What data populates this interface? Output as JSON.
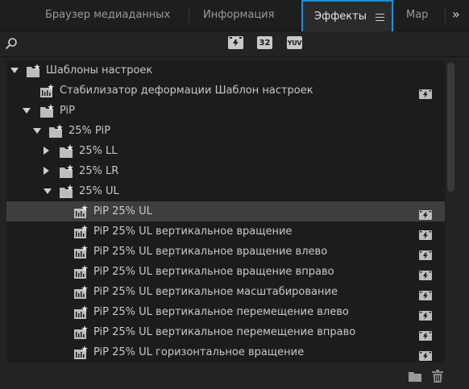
{
  "tabs": [
    {
      "label": "Браузер медиаданных",
      "active": false
    },
    {
      "label": "Информация",
      "active": false
    },
    {
      "label": "Эффекты",
      "active": true
    },
    {
      "label": "Мар",
      "active": false
    }
  ],
  "overflow_glyph": "»",
  "toolbar": {
    "accelerated_glyph": "",
    "bit32_label": "32",
    "yuv_label": "YUV"
  },
  "tree": [
    {
      "label": "Шаблоны настроек",
      "kind": "folder",
      "expand": "down",
      "depth": 0,
      "accel": false,
      "selected": false
    },
    {
      "label": "Стабилизатор деформации Шаблон настроек",
      "kind": "preset",
      "expand": "none",
      "depth": 1,
      "accel": true,
      "selected": false
    },
    {
      "label": "PiP",
      "kind": "folder",
      "expand": "down",
      "depth": 1,
      "accel": false,
      "selected": false
    },
    {
      "label": "25% PiP",
      "kind": "folder",
      "expand": "down",
      "depth": 2,
      "accel": false,
      "selected": false
    },
    {
      "label": "25% LL",
      "kind": "folder",
      "expand": "right",
      "depth": 3,
      "accel": false,
      "selected": false
    },
    {
      "label": "25% LR",
      "kind": "folder",
      "expand": "right",
      "depth": 3,
      "accel": false,
      "selected": false
    },
    {
      "label": "25% UL",
      "kind": "folder",
      "expand": "down",
      "depth": 3,
      "accel": false,
      "selected": false
    },
    {
      "label": "PiP 25% UL",
      "kind": "preset",
      "expand": "none",
      "depth": 4,
      "accel": true,
      "selected": true
    },
    {
      "label": "PiP 25% UL вертикальное вращение",
      "kind": "preset",
      "expand": "none",
      "depth": 4,
      "accel": true,
      "selected": false
    },
    {
      "label": "PiP 25% UL вертикальное вращение влево",
      "kind": "preset",
      "expand": "none",
      "depth": 4,
      "accel": true,
      "selected": false
    },
    {
      "label": "PiP 25% UL вертикальное вращение вправо",
      "kind": "preset",
      "expand": "none",
      "depth": 4,
      "accel": true,
      "selected": false
    },
    {
      "label": "PiP 25% UL вертикальное масштабирование",
      "kind": "preset",
      "expand": "none",
      "depth": 4,
      "accel": true,
      "selected": false
    },
    {
      "label": "PiP 25% UL вертикальное перемещение влево",
      "kind": "preset",
      "expand": "none",
      "depth": 4,
      "accel": true,
      "selected": false
    },
    {
      "label": "PiP 25% UL вертикальное перемещение вправо",
      "kind": "preset",
      "expand": "none",
      "depth": 4,
      "accel": true,
      "selected": false
    },
    {
      "label": "PiP 25% UL горизонтальное вращение",
      "kind": "preset",
      "expand": "none",
      "depth": 4,
      "accel": true,
      "selected": false
    }
  ],
  "icons": {
    "search": "search-icon",
    "new_bin": "new-folder-icon",
    "delete": "trash-icon"
  },
  "colors": {
    "accent": "#1b8fe0",
    "panel_bg": "#232323",
    "tree_bg": "#1c1c1c",
    "selected_row": "#3e3e3e"
  }
}
